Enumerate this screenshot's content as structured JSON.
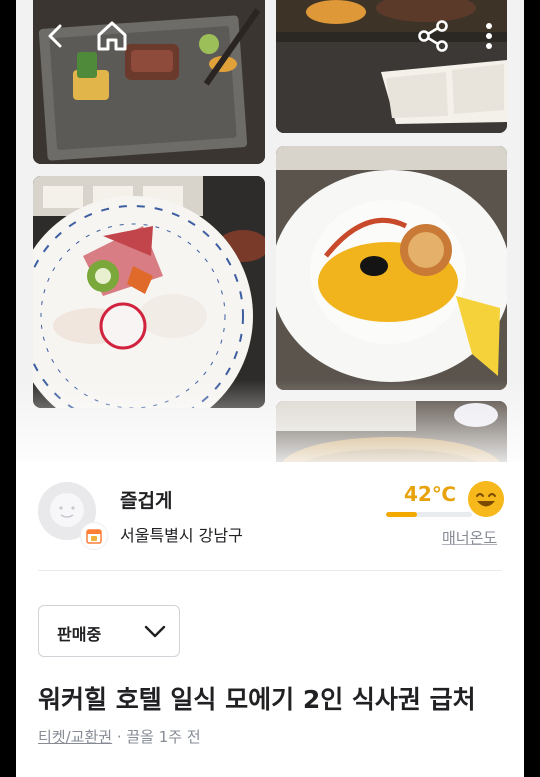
{
  "header": {
    "back_icon": "chevron-left-icon",
    "home_icon": "home-icon",
    "share_icon": "share-icon",
    "more_icon": "more-vertical-icon"
  },
  "gallery": {
    "photos": [
      "steak-plate-photo",
      "teppanyaki-grill-photo",
      "sashimi-plate-photo",
      "lobster-dish-photo",
      "bamboo-steamer-photo"
    ]
  },
  "seller": {
    "nickname": "즐겁게",
    "region": "서울특별시 강남구",
    "manner_temp": "42℃",
    "manner_temp_value": 42,
    "manner_label": "매너온도",
    "temp_color": "#e8a30c"
  },
  "post": {
    "status": "판매중",
    "title": "워커힐 호텔 일식 모에기 2인 식사권 급처",
    "category": "티켓/교환권",
    "bumped": "끌올 1주 전",
    "separator": " · "
  }
}
